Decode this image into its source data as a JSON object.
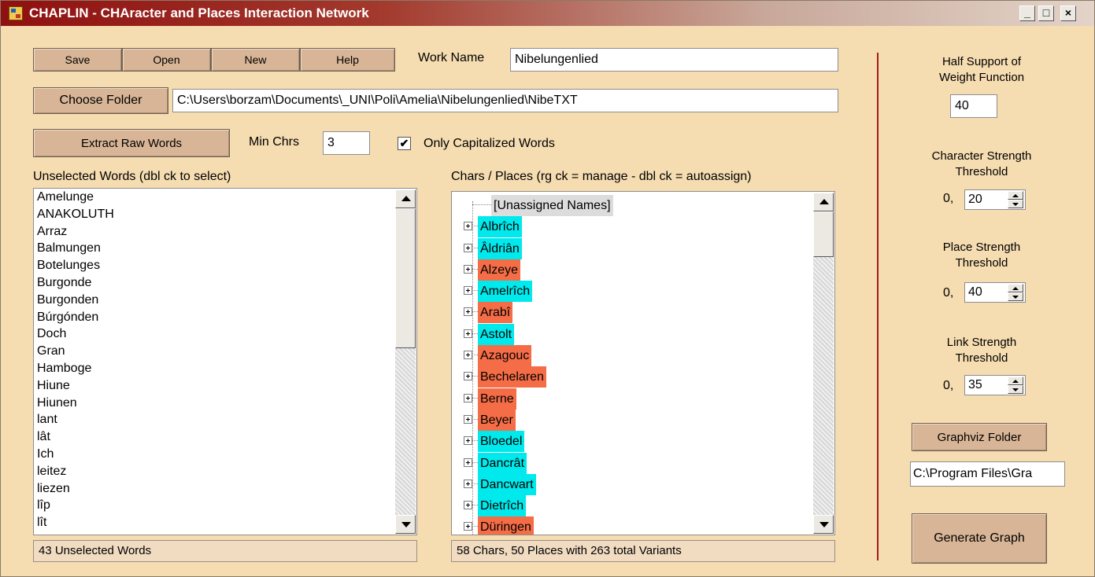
{
  "window": {
    "title": "CHAPLIN - CHAracter and Places Interaction Network",
    "minimize_label": "_",
    "maximize_label": "□",
    "close_label": "×"
  },
  "toolbar": {
    "save_label": "Save",
    "open_label": "Open",
    "new_label": "New",
    "help_label": "Help",
    "work_name_label": "Work Name",
    "work_name_value": "Nibelungenlied"
  },
  "folder": {
    "choose_label": "Choose Folder",
    "path_value": "C:\\Users\\borzam\\Documents\\_UNI\\Poli\\Amelia\\Nibelungenlied\\NibeTXT"
  },
  "extract": {
    "button_label": "Extract Raw Words",
    "min_chrs_label": "Min Chrs",
    "min_chrs_value": "3",
    "only_cap_label": "Only Capitalized Words",
    "only_cap_checked": true,
    "check_mark": "✔"
  },
  "unselected": {
    "header": "Unselected Words (dbl ck to select)",
    "words": [
      "Amelunge",
      "ANAKOLUTH",
      "Arraz",
      "Balmungen",
      "Botelunges",
      "Burgonde",
      "Burgonden",
      "Búrgónden",
      "Doch",
      "Gran",
      "Hamboge",
      "Hiune",
      "Hiunen",
      "lant",
      "lât",
      "Ich",
      "leitez",
      "liezen",
      "lîp",
      "lît"
    ],
    "status": "43 Unselected Words"
  },
  "chars_places": {
    "header": "Chars / Places (rg ck = manage - dbl ck = autoassign)",
    "unassigned_label": "[Unassigned Names]",
    "nodes": [
      {
        "label": "Albrîch",
        "type": "character"
      },
      {
        "label": "Âldriân",
        "type": "character"
      },
      {
        "label": "Alzeye",
        "type": "place"
      },
      {
        "label": "Amelrîch",
        "type": "character"
      },
      {
        "label": "Arabî",
        "type": "place"
      },
      {
        "label": "Astolt",
        "type": "character"
      },
      {
        "label": "Azagouc",
        "type": "place"
      },
      {
        "label": "Bechelaren",
        "type": "place"
      },
      {
        "label": "Berne",
        "type": "place"
      },
      {
        "label": "Beyer",
        "type": "place"
      },
      {
        "label": "Bloedel",
        "type": "character"
      },
      {
        "label": "Dancrât",
        "type": "character"
      },
      {
        "label": "Dancwart",
        "type": "character"
      },
      {
        "label": "Dietrîch",
        "type": "character"
      },
      {
        "label": "Düringen",
        "type": "place"
      }
    ],
    "status": "58 Chars, 50 Places with 263 total Variants",
    "colors": {
      "character": "#00e9ec",
      "place": "#f56d47"
    }
  },
  "settings": {
    "half_support_label": "Half Support of\nWeight Function",
    "half_support_value": "40",
    "char_strength_label": "Character Strength\nThreshold",
    "char_strength_prefix": "0,",
    "char_strength_value": "20",
    "place_strength_label": "Place Strength\nThreshold",
    "place_strength_prefix": "0,",
    "place_strength_value": "40",
    "link_strength_label": "Link Strength\nThreshold",
    "link_strength_prefix": "0,",
    "link_strength_value": "35",
    "graphviz_button_label": "Graphviz Folder",
    "graphviz_path_value": "C:\\Program Files\\Gra",
    "generate_button_label": "Generate Graph"
  }
}
